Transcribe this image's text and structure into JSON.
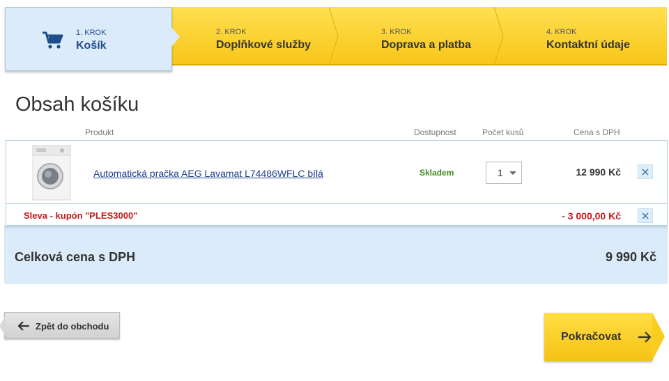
{
  "steps": [
    {
      "num": "1. KROK",
      "title": "Košík"
    },
    {
      "num": "2. KROK",
      "title": "Doplňkové služby"
    },
    {
      "num": "3. KROK",
      "title": "Doprava a platba"
    },
    {
      "num": "4. KROK",
      "title": "Kontaktní údaje"
    }
  ],
  "page_title": "Obsah košíku",
  "table_headers": {
    "product": "Produkt",
    "availability": "Dostupnost",
    "quantity": "Počet kusů",
    "price": "Cena s DPH"
  },
  "item": {
    "name": "Automatická pračka AEG Lavamat L74486WFLC bílá",
    "availability": "Skladem",
    "quantity": "1",
    "price": "12 990 Kč",
    "remove_icon": "close-icon"
  },
  "discount": {
    "label": "Sleva - kupón \"PLES3000\"",
    "amount": "- 3 000,00 Kč"
  },
  "total": {
    "label": "Celková cena s DPH",
    "value": "9 990 Kč"
  },
  "buttons": {
    "back": "Zpět do obchodu",
    "continue": "Pokračovat"
  },
  "colors": {
    "accent_yellow": "#f7c61a",
    "active_step_bg": "#dcebfa",
    "in_stock": "#3f8b1e",
    "discount_red": "#c41a1a",
    "link_blue": "#1f3e8c"
  }
}
